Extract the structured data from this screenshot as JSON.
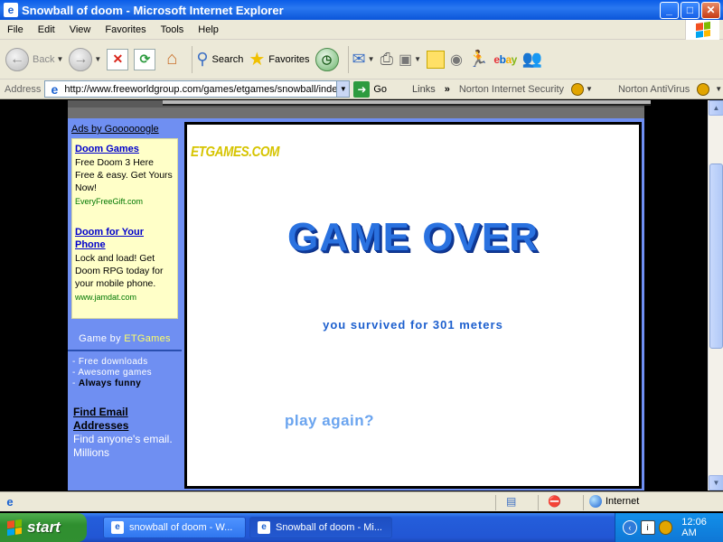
{
  "window": {
    "title": "Snowball of doom - Microsoft Internet Explorer",
    "minimize": "_",
    "maximize": "□",
    "close": "✕"
  },
  "menu": {
    "items": [
      {
        "label": "File"
      },
      {
        "label": "Edit"
      },
      {
        "label": "View"
      },
      {
        "label": "Favorites"
      },
      {
        "label": "Tools"
      },
      {
        "label": "Help"
      }
    ]
  },
  "toolbar": {
    "back": "Back",
    "search": "Search",
    "favorites": "Favorites"
  },
  "address": {
    "label": "Address",
    "url": "http://www.freeworldgroup.com/games/etgames/snowball/inde",
    "go": "Go",
    "links": "Links",
    "norton_is": "Norton Internet Security",
    "norton_av": "Norton AntiVirus"
  },
  "sidebar": {
    "ads_header": "Ads by Goooooogle",
    "ads": [
      {
        "title": "Doom Games",
        "body": "Free Doom 3 Here Free & easy. Get Yours Now!",
        "url": "EveryFreeGift.com"
      },
      {
        "title": "Doom for Your Phone",
        "body": "Lock and load! Get Doom RPG today for your mobile phone.",
        "url": "www.jamdat.com"
      }
    ],
    "game_by_prefix": "Game by ",
    "game_by_brand": "ETGames",
    "blurbs": [
      "- Free downloads",
      "- Awesome games"
    ],
    "blurb_strong": "Always funny",
    "find_title": "Find Email Addresses",
    "find_body": "Find anyone's email. Millions"
  },
  "game": {
    "logo": "ETGAMES.COM",
    "headline": "GAME OVER",
    "result": "you survived for 301 meters",
    "play_again": "play again?"
  },
  "status": {
    "zone": "Internet"
  },
  "taskbar": {
    "start": "start",
    "tasks": [
      {
        "label": "snowball of doom - W..."
      },
      {
        "label": "Snowball of doom - Mi..."
      }
    ],
    "time": "12:06 AM"
  },
  "colors": {
    "sidebar_blue": "#6f8ff2",
    "game_over_blue": "#2a72e0",
    "logo_yellow": "#d6c400",
    "play_again": "#6aa4ef"
  }
}
